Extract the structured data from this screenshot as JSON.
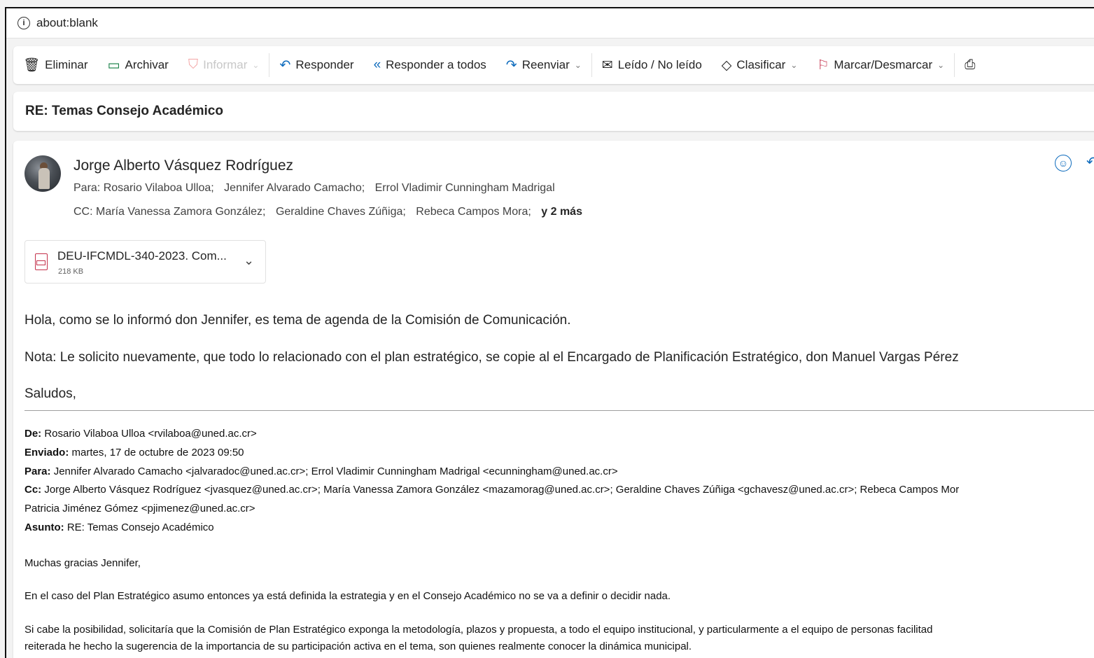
{
  "address_bar": {
    "url": "about:blank"
  },
  "toolbar": {
    "eliminar": "Eliminar",
    "archivar": "Archivar",
    "informar": "Informar",
    "responder": "Responder",
    "responder_todos": "Responder a todos",
    "reenviar": "Reenviar",
    "leido": "Leído / No leído",
    "clasificar": "Clasificar",
    "marcar": "Marcar/Desmarcar"
  },
  "subject": "RE: Temas Consejo Académico",
  "message": {
    "sender": "Jorge Alberto Vásquez Rodríguez",
    "to_label": "Para:",
    "to": [
      "Rosario Vilaboa Ulloa;",
      "Jennifer Alvarado Camacho;",
      "Errol Vladimir Cunningham Madrigal"
    ],
    "cc_label": "CC:",
    "cc": [
      "María Vanessa Zamora González;",
      "Geraldine Chaves Zúñiga;",
      "Rebeca Campos Mora;"
    ],
    "cc_more": "y 2 más",
    "attachment": {
      "name": "DEU-IFCMDL-340-2023. Com...",
      "size": "218 KB"
    },
    "body": [
      "Hola, como se lo informó don Jennifer, es tema de agenda de la Comisión de Comunicación.",
      "Nota: Le solicito nuevamente, que todo lo relacionado con el plan estratégico, se copie al el Encargado de Planificación Estratégico, don Manuel Vargas Pérez",
      "Saludos,"
    ]
  },
  "quoted": {
    "de_label": "De:",
    "de": " Rosario Vilaboa Ulloa <rvilaboa@uned.ac.cr>",
    "enviado_label": "Enviado:",
    "enviado": " martes, 17 de octubre de 2023 09:50",
    "para_label": "Para:",
    "para": " Jennifer Alvarado Camacho <jalvaradoc@uned.ac.cr>; Errol Vladimir Cunningham Madrigal <ecunningham@uned.ac.cr>",
    "cc_label": "Cc:",
    "cc": " Jorge Alberto Vásquez Rodríguez <jvasquez@uned.ac.cr>; María Vanessa Zamora González <mazamorag@uned.ac.cr>; Geraldine Chaves Zúñiga <gchavesz@uned.ac.cr>; Rebeca Campos Mor",
    "cc_cont": "Patricia Jiménez Gómez <pjimenez@uned.ac.cr>",
    "asunto_label": "Asunto:",
    "asunto": " RE: Temas Consejo Académico",
    "body": [
      "Muchas gracias Jennifer,",
      "En el caso del Plan Estratégico asumo entonces ya está definida la estrategia y en el Consejo Académico no se va a definir o decidir nada.",
      "Si cabe la posibilidad, solicitaría que la Comisión de Plan Estratégico exponga la metodología, plazos y propuesta, a todo el equipo institucional, y particularmente a el equipo de personas facilitad",
      "reiterada he hecho la sugerencia de la importancia de su participación activa en el tema, son quienes realmente conocer la dinámica municipal."
    ]
  }
}
